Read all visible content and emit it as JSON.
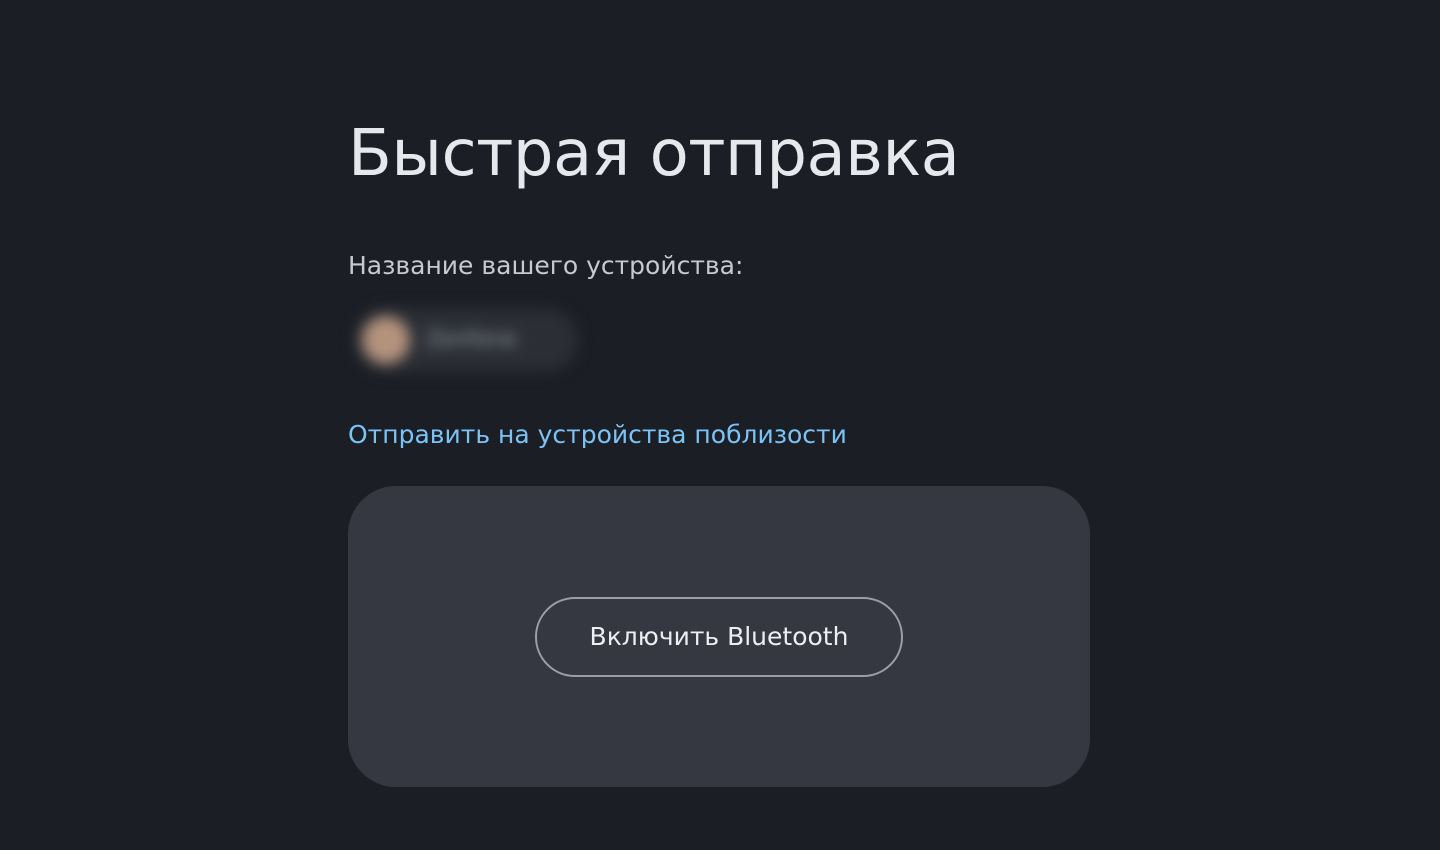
{
  "page": {
    "title": "Быстрая отправка"
  },
  "device": {
    "label": "Название вашего устройства:",
    "name": "Zenfone"
  },
  "nearby": {
    "link_label": "Отправить на устройства поблизости"
  },
  "bluetooth": {
    "enable_label": "Включить Bluetooth"
  },
  "colors": {
    "background": "#1b1e25",
    "panel": "#353841",
    "link": "#7cc3f5",
    "text": "#e6e8ec"
  }
}
